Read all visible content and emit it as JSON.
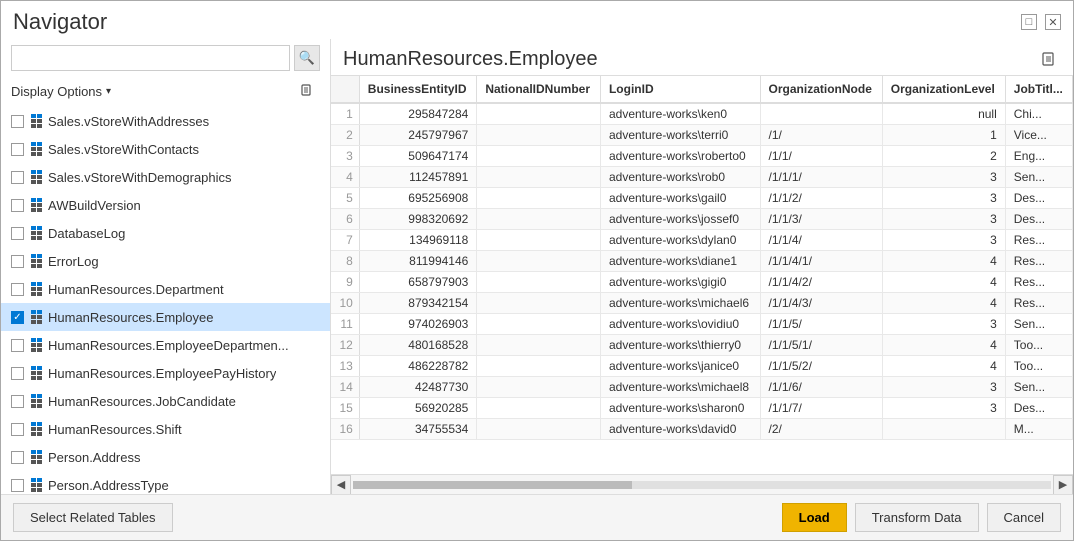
{
  "window": {
    "title": "Navigator"
  },
  "search": {
    "placeholder": ""
  },
  "displayOptions": {
    "label": "Display Options",
    "arrow": "▾"
  },
  "navList": {
    "items": [
      {
        "id": 1,
        "label": "Sales.vStoreWithAddresses",
        "checked": false,
        "type": "table",
        "truncated": true
      },
      {
        "id": 2,
        "label": "Sales.vStoreWithContacts",
        "checked": false,
        "type": "table"
      },
      {
        "id": 3,
        "label": "Sales.vStoreWithDemographics",
        "checked": false,
        "type": "table"
      },
      {
        "id": 4,
        "label": "AWBuildVersion",
        "checked": false,
        "type": "table"
      },
      {
        "id": 5,
        "label": "DatabaseLog",
        "checked": false,
        "type": "table"
      },
      {
        "id": 6,
        "label": "ErrorLog",
        "checked": false,
        "type": "table"
      },
      {
        "id": 7,
        "label": "HumanResources.Department",
        "checked": false,
        "type": "table"
      },
      {
        "id": 8,
        "label": "HumanResources.Employee",
        "checked": true,
        "type": "table",
        "selected": true
      },
      {
        "id": 9,
        "label": "HumanResources.EmployeeDepartmen...",
        "checked": false,
        "type": "table"
      },
      {
        "id": 10,
        "label": "HumanResources.EmployeePayHistory",
        "checked": false,
        "type": "table"
      },
      {
        "id": 11,
        "label": "HumanResources.JobCandidate",
        "checked": false,
        "type": "table"
      },
      {
        "id": 12,
        "label": "HumanResources.Shift",
        "checked": false,
        "type": "table"
      },
      {
        "id": 13,
        "label": "Person.Address",
        "checked": false,
        "type": "table"
      },
      {
        "id": 14,
        "label": "Person.AddressType",
        "checked": false,
        "type": "table"
      }
    ]
  },
  "preview": {
    "title": "HumanResources.Employee",
    "columns": [
      "BusinessEntityID",
      "NationalIDNumber",
      "LoginID",
      "OrganizationNode",
      "OrganizationLevel",
      "JobTitl..."
    ],
    "rows": [
      {
        "num": 1,
        "BusinessEntityID": "295847284",
        "NationalIDNumber": "",
        "LoginID": "adventure-works\\ken0",
        "OrganizationNode": "",
        "OrganizationLevel": "null",
        "JobTitle": "Chi..."
      },
      {
        "num": 2,
        "BusinessEntityID": "245797967",
        "NationalIDNumber": "",
        "LoginID": "adventure-works\\terri0",
        "OrganizationNode": "/1/",
        "OrganizationLevel": "1",
        "JobTitle": "Vice..."
      },
      {
        "num": 3,
        "BusinessEntityID": "509647174",
        "NationalIDNumber": "",
        "LoginID": "adventure-works\\roberto0",
        "OrganizationNode": "/1/1/",
        "OrganizationLevel": "2",
        "JobTitle": "Eng..."
      },
      {
        "num": 4,
        "BusinessEntityID": "112457891",
        "NationalIDNumber": "",
        "LoginID": "adventure-works\\rob0",
        "OrganizationNode": "/1/1/1/",
        "OrganizationLevel": "3",
        "JobTitle": "Sen..."
      },
      {
        "num": 5,
        "BusinessEntityID": "695256908",
        "NationalIDNumber": "",
        "LoginID": "adventure-works\\gail0",
        "OrganizationNode": "/1/1/2/",
        "OrganizationLevel": "3",
        "JobTitle": "Des..."
      },
      {
        "num": 6,
        "BusinessEntityID": "998320692",
        "NationalIDNumber": "",
        "LoginID": "adventure-works\\jossef0",
        "OrganizationNode": "/1/1/3/",
        "OrganizationLevel": "3",
        "JobTitle": "Des..."
      },
      {
        "num": 7,
        "BusinessEntityID": "134969118",
        "NationalIDNumber": "",
        "LoginID": "adventure-works\\dylan0",
        "OrganizationNode": "/1/1/4/",
        "OrganizationLevel": "3",
        "JobTitle": "Res..."
      },
      {
        "num": 8,
        "BusinessEntityID": "811994146",
        "NationalIDNumber": "",
        "LoginID": "adventure-works\\diane1",
        "OrganizationNode": "/1/1/4/1/",
        "OrganizationLevel": "4",
        "JobTitle": "Res..."
      },
      {
        "num": 9,
        "BusinessEntityID": "658797903",
        "NationalIDNumber": "",
        "LoginID": "adventure-works\\gigi0",
        "OrganizationNode": "/1/1/4/2/",
        "OrganizationLevel": "4",
        "JobTitle": "Res..."
      },
      {
        "num": 10,
        "BusinessEntityID": "879342154",
        "NationalIDNumber": "",
        "LoginID": "adventure-works\\michael6",
        "OrganizationNode": "/1/1/4/3/",
        "OrganizationLevel": "4",
        "JobTitle": "Res..."
      },
      {
        "num": 11,
        "BusinessEntityID": "974026903",
        "NationalIDNumber": "",
        "LoginID": "adventure-works\\ovidiu0",
        "OrganizationNode": "/1/1/5/",
        "OrganizationLevel": "3",
        "JobTitle": "Sen..."
      },
      {
        "num": 12,
        "BusinessEntityID": "480168528",
        "NationalIDNumber": "",
        "LoginID": "adventure-works\\thierry0",
        "OrganizationNode": "/1/1/5/1/",
        "OrganizationLevel": "4",
        "JobTitle": "Too..."
      },
      {
        "num": 13,
        "BusinessEntityID": "486228782",
        "NationalIDNumber": "",
        "LoginID": "adventure-works\\janice0",
        "OrganizationNode": "/1/1/5/2/",
        "OrganizationLevel": "4",
        "JobTitle": "Too..."
      },
      {
        "num": 14,
        "BusinessEntityID": "42487730",
        "NationalIDNumber": "",
        "LoginID": "adventure-works\\michael8",
        "OrganizationNode": "/1/1/6/",
        "OrganizationLevel": "3",
        "JobTitle": "Sen..."
      },
      {
        "num": 15,
        "BusinessEntityID": "56920285",
        "NationalIDNumber": "",
        "LoginID": "adventure-works\\sharon0",
        "OrganizationNode": "/1/1/7/",
        "OrganizationLevel": "3",
        "JobTitle": "Des..."
      },
      {
        "num": 16,
        "BusinessEntityID": "34755534",
        "NationalIDNumber": "",
        "LoginID": "adventure-works\\david0",
        "OrganizationNode": "/2/",
        "OrganizationLevel": "",
        "JobTitle": "M..."
      }
    ]
  },
  "footer": {
    "selectRelatedTables": "Select Related Tables",
    "load": "Load",
    "transformData": "Transform Data",
    "cancel": "Cancel"
  }
}
